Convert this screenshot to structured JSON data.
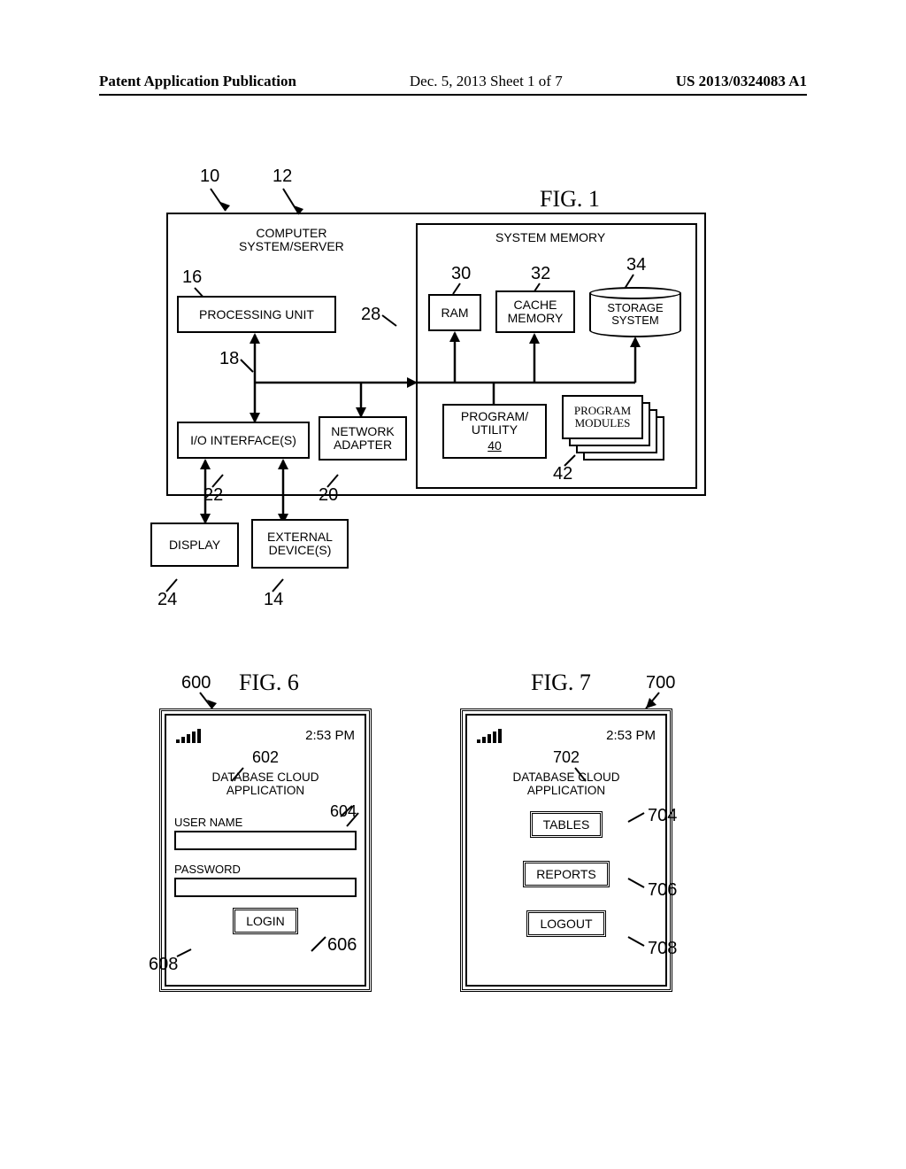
{
  "header": {
    "left": "Patent Application Publication",
    "mid": "Dec. 5, 2013  Sheet 1 of 7",
    "right": "US 2013/0324083 A1"
  },
  "fig1": {
    "title": "FIG. 1",
    "refs": {
      "r10": "10",
      "r12": "12",
      "r16": "16",
      "r18": "18",
      "r28": "28",
      "r30": "30",
      "r32": "32",
      "r34": "34",
      "r40": "40",
      "r42": "42",
      "r22": "22",
      "r20": "20",
      "r24": "24",
      "r14": "14"
    },
    "labels": {
      "computer_system_server": "COMPUTER\nSYSTEM/SERVER",
      "processing_unit": "PROCESSING UNIT",
      "system_memory": "SYSTEM MEMORY",
      "ram": "RAM",
      "cache_memory": "CACHE\nMEMORY",
      "storage_system": "STORAGE\nSYSTEM",
      "program_utility": "PROGRAM/\nUTILITY",
      "program_modules": "PROGRAM\nMODULES",
      "io_interfaces": "I/O INTERFACE(S)",
      "network_adapter": "NETWORK\nADAPTER",
      "display": "DISPLAY",
      "external_devices": "EXTERNAL\nDEVICE(S)"
    }
  },
  "fig6": {
    "title": "FIG. 6",
    "refs": {
      "r600": "600",
      "r602": "602",
      "r604": "604",
      "r606": "606",
      "r608": "608"
    },
    "time": "2:53 PM",
    "app_title": "DATABASE CLOUD APPLICATION",
    "user_label": "USER NAME",
    "pass_label": "PASSWORD",
    "login": "LOGIN"
  },
  "fig7": {
    "title": "FIG. 7",
    "refs": {
      "r700": "700",
      "r702": "702",
      "r704": "704",
      "r706": "706",
      "r708": "708"
    },
    "time": "2:53 PM",
    "app_title": "DATABASE CLOUD APPLICATION",
    "tables": "TABLES",
    "reports": "REPORTS",
    "logout": "LOGOUT"
  }
}
